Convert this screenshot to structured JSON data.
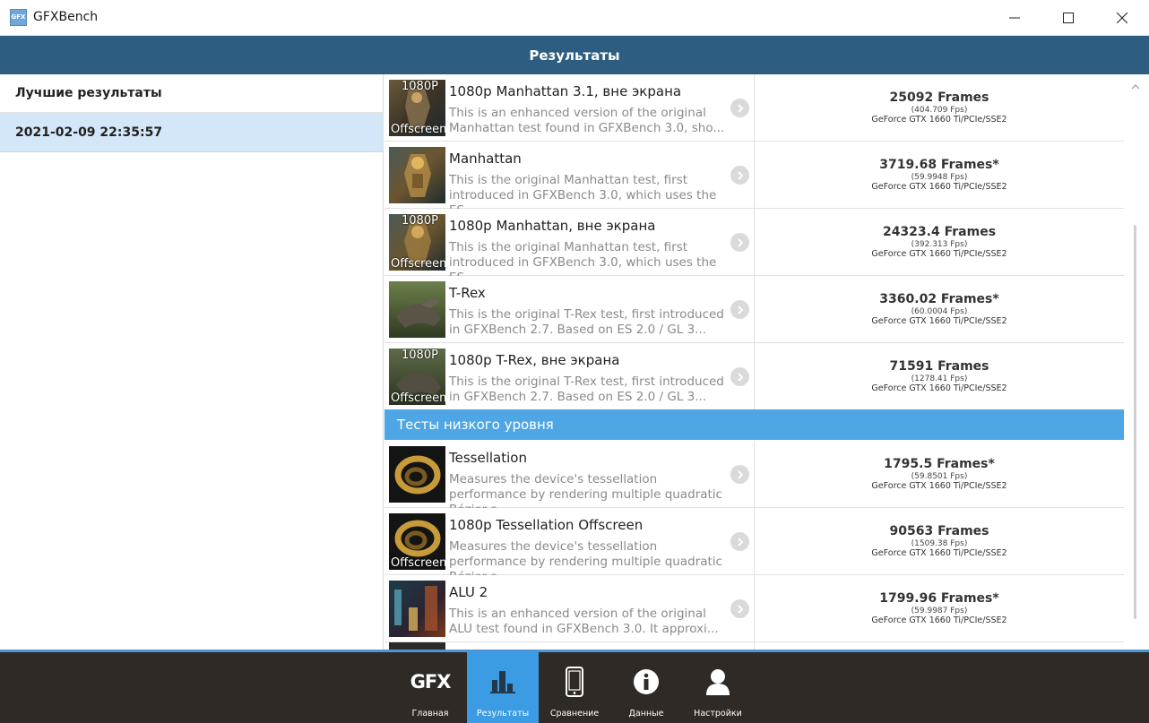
{
  "window": {
    "title": "GFXBench",
    "icon_label": "GFX",
    "icons": {
      "minimize": "minimize-icon",
      "maximize": "maximize-icon",
      "close": "close-icon"
    }
  },
  "header": {
    "title": "Результаты"
  },
  "sidebar": {
    "heading": "Лучшие результаты",
    "items": [
      {
        "label": "2021-02-09 22:35:57",
        "selected": true
      }
    ]
  },
  "results": [
    {
      "name": "1080p Manhattan 3.1, вне экрана",
      "tag_top": "1080P",
      "tag_bottom": "Offscreen",
      "desc": "This is an enhanced version of the original Manhattan test found in GFXBench 3.0, sho...",
      "score": "25092 Frames",
      "fps": "(404.709 Fps)",
      "device": "GeForce GTX 1660 Ti/PCIe/SSE2"
    },
    {
      "name": "Manhattan",
      "tag_top": "",
      "tag_bottom": "",
      "desc": "This is the original Manhattan test, first introduced in GFXBench 3.0, which uses the ES...",
      "score": "3719.68 Frames*",
      "fps": "(59.9948 Fps)",
      "device": "GeForce GTX 1660 Ti/PCIe/SSE2"
    },
    {
      "name": "1080p Manhattan, вне экрана",
      "tag_top": "1080P",
      "tag_bottom": "Offscreen",
      "desc": "This is the original Manhattan test, first introduced in GFXBench 3.0, which uses the ES...",
      "score": "24323.4 Frames",
      "fps": "(392.313 Fps)",
      "device": "GeForce GTX 1660 Ti/PCIe/SSE2"
    },
    {
      "name": "T-Rex",
      "tag_top": "",
      "tag_bottom": "",
      "desc": "This is the original T-Rex test, first introduced in GFXBench 2.7. Based on ES 2.0 / GL 3...",
      "score": "3360.02 Frames*",
      "fps": "(60.0004 Fps)",
      "device": "GeForce GTX 1660 Ti/PCIe/SSE2"
    },
    {
      "name": "1080p T-Rex, вне экрана",
      "tag_top": "1080P",
      "tag_bottom": "Offscreen",
      "desc": "This is the original T-Rex test, first introduced in GFXBench 2.7. Based on ES 2.0 / GL 3...",
      "score": "71591 Frames",
      "fps": "(1278.41 Fps)",
      "device": "GeForce GTX 1660 Ti/PCIe/SSE2"
    }
  ],
  "section_low_level": {
    "title": "Тесты низкого уровня"
  },
  "results_low": [
    {
      "name": "Tessellation",
      "tag_top": "",
      "tag_bottom": "",
      "desc": "Measures the device's tessellation performance by rendering multiple quadratic Bézier s...",
      "score": "1795.5 Frames*",
      "fps": "(59.8501 Fps)",
      "device": "GeForce GTX 1660 Ti/PCIe/SSE2"
    },
    {
      "name": "1080p Tessellation Offscreen",
      "tag_top": "",
      "tag_bottom": "Offscreen",
      "desc": "Measures the device's tessellation performance by rendering multiple quadratic Bézier s...",
      "score": "90563 Frames",
      "fps": "(1509.38 Fps)",
      "device": "GeForce GTX 1660 Ti/PCIe/SSE2"
    },
    {
      "name": "ALU 2",
      "tag_top": "",
      "tag_bottom": "",
      "desc": "This is an enhanced version of the original ALU test found in GFXBench 3.0. It approxi...",
      "score": "1799.96 Frames*",
      "fps": "(59.9987 Fps)",
      "device": "GeForce GTX 1660 Ti/PCIe/SSE2"
    }
  ],
  "nav": {
    "logo": "GFX",
    "items": [
      {
        "label": "Главная",
        "icon": "gfx-logo-icon",
        "active": false
      },
      {
        "label": "Результаты",
        "icon": "bar-chart-icon",
        "active": true
      },
      {
        "label": "Сравнение",
        "icon": "phone-icon",
        "active": false
      },
      {
        "label": "Данные",
        "icon": "info-icon",
        "active": false
      },
      {
        "label": "Настройки",
        "icon": "user-icon",
        "active": false
      }
    ]
  },
  "colors": {
    "header_bg": "#2d5d80",
    "selected_bg": "#d4e7f8",
    "section_bg": "#4ea6e4",
    "nav_bg": "#2f2a26",
    "nav_active": "#3b9be3"
  }
}
